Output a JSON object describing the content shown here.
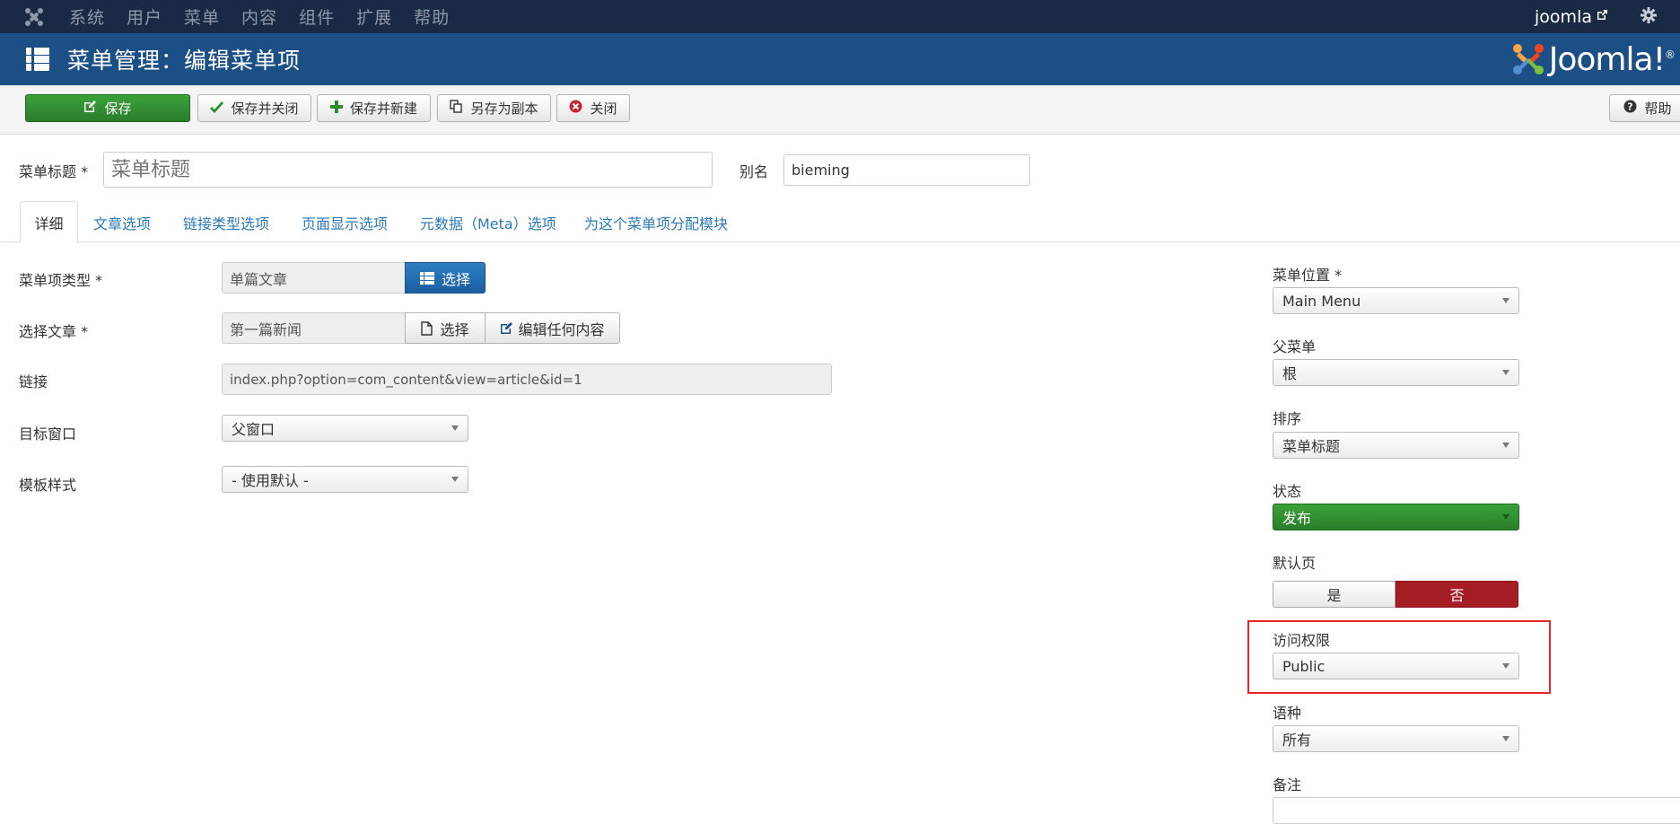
{
  "topnav": {
    "menu": [
      "系统",
      "用户",
      "菜单",
      "内容",
      "组件",
      "扩展",
      "帮助"
    ],
    "user": "joomla",
    "icons": [
      "joomla-logo-icon",
      "external-link-icon",
      "gear-icon"
    ]
  },
  "header": {
    "title": "菜单管理：编辑菜单项",
    "brand": "Joomla!",
    "brand_base": "Joomla",
    "brand_mark": "!",
    "brand_sup": "®"
  },
  "toolbar": {
    "save": "保存",
    "save_close": "保存并关闭",
    "save_new": "保存并新建",
    "save_copy": "另存为副本",
    "close": "关闭",
    "help": "帮助"
  },
  "title_row": {
    "title_label": "菜单标题 *",
    "title_placeholder": "菜单标题",
    "alias_label": "别名",
    "alias_value": "bieming"
  },
  "tabs": [
    "详细",
    "文章选项",
    "链接类型选项",
    "页面显示选项",
    "元数据（Meta）选项",
    "为这个菜单项分配模块"
  ],
  "form": {
    "type_label": "菜单项类型 *",
    "type_value": "单篇文章",
    "type_btn": "选择",
    "article_label": "选择文章 *",
    "article_value": "第一篇新闻",
    "article_select": "选择",
    "article_edit": "编辑任何内容",
    "link_label": "链接",
    "link_value": "index.php?option=com_content&view=article&id=1",
    "target_label": "目标窗口",
    "target_value": "父窗口",
    "template_label": "模板样式",
    "template_value": "- 使用默认 -"
  },
  "sidebar": {
    "menu_label": "菜单位置 *",
    "menu_value": "Main Menu",
    "parent_label": "父菜单",
    "parent_value": "根",
    "order_label": "排序",
    "order_value": "菜单标题",
    "status_label": "状态",
    "status_value": "发布",
    "default_label": "默认页",
    "default_yes": "是",
    "default_no": "否",
    "access_label": "访问权限",
    "access_value": "Public",
    "lang_label": "语种",
    "lang_value": "所有",
    "note_label": "备注"
  },
  "colors": {
    "topnav": "#1b2a44",
    "header": "#1b4f86",
    "save_green": "#2e8b2e",
    "no_red": "#a41d24",
    "highlight": "#e8262a"
  }
}
